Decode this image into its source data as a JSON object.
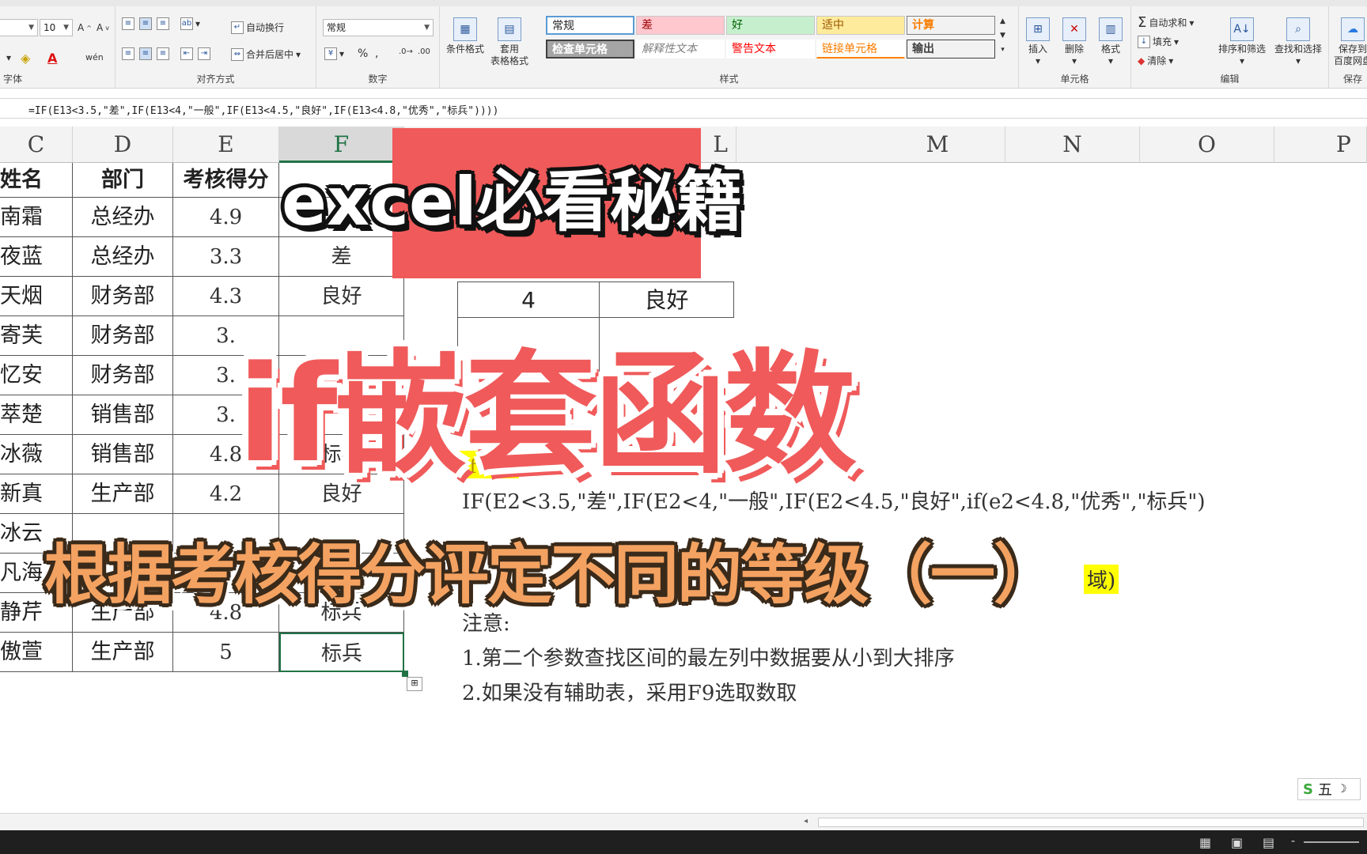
{
  "ribbon": {
    "font_size": "10",
    "wrap_text": "自动换行",
    "merge_center": "合并后居中",
    "number_format": "常规",
    "cond_format": "条件格式",
    "table_format_1": "套用",
    "table_format_2": "表格格式",
    "styles": {
      "normal": "常规",
      "bad": "差",
      "good": "好",
      "neutral": "适中",
      "calc": "计算",
      "check_cell": "检查单元格",
      "explanatory": "解释性文本",
      "warning": "警告文本",
      "linked_cell": "链接单元格",
      "output": "输出"
    },
    "insert": "插入",
    "delete": "删除",
    "format": "格式",
    "autosum": "自动求和",
    "fill": "填充",
    "clear": "清除",
    "sort_filter": "排序和筛选",
    "find_select": "查找和选择",
    "save_baidu_1": "保存到",
    "save_baidu_2": "百度网盘",
    "group_font": "字体",
    "group_align": "对齐方式",
    "group_number": "数字",
    "group_styles": "样式",
    "group_cells": "单元格",
    "group_edit": "编辑",
    "group_save": "保存"
  },
  "formula_bar": {
    "formula": "=IF(E13<3.5,\"差\",IF(E13<4,\"一般\",IF(E13<4.5,\"良好\",IF(E13<4.8,\"优秀\",\"标兵\"))))"
  },
  "columns": [
    "C",
    "D",
    "E",
    "F",
    "L",
    "M",
    "N",
    "O",
    "P"
  ],
  "table": {
    "headers": [
      "姓名",
      "部门",
      "考核得分"
    ],
    "rows": [
      [
        "南霜",
        "总经办",
        "4.9",
        ""
      ],
      [
        "夜蓝",
        "总经办",
        "3.3",
        "差"
      ],
      [
        "天烟",
        "财务部",
        "4.3",
        "良好"
      ],
      [
        "寄芙",
        "财务部",
        "3.",
        ""
      ],
      [
        "忆安",
        "财务部",
        "3.",
        ""
      ],
      [
        "萃楚",
        "销售部",
        "3.",
        ""
      ],
      [
        "冰薇",
        "销售部",
        "4.8",
        "标兵"
      ],
      [
        "新真",
        "生产部",
        "4.2",
        "良好"
      ],
      [
        "冰云",
        "",
        "",
        ""
      ],
      [
        "凡海",
        "",
        "",
        ""
      ],
      [
        "静芹",
        "生产部",
        "4.8",
        "标兵"
      ],
      [
        "傲萱",
        "生产部",
        "5",
        "标兵"
      ]
    ]
  },
  "side_table": {
    "value": "4",
    "grade": "良好"
  },
  "notes": {
    "if_label": "If语句",
    "formula": "IF(E2<3.5,\"差\",IF(E2<4,\"一般\",IF(E2<4.5,\"良好\",if(e2<4.8,\"优秀\",\"标兵\")",
    "region_tail": "域)",
    "attention": "注意:",
    "note1": "1.第二个参数查找区间的最左列中数据要从小到大排序",
    "note2": "2.如果没有辅助表，采用F9选取数取"
  },
  "overlay": {
    "title1": "excel必看秘籍",
    "title2": "if嵌套函数",
    "title3": "根据考核得分评定不同的等级（一）"
  },
  "ime": {
    "label": "五"
  }
}
